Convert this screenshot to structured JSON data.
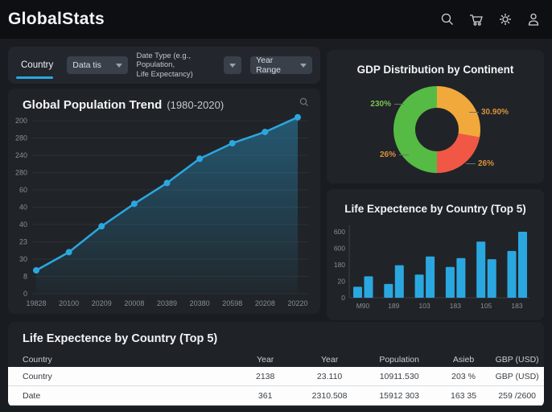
{
  "colors": {
    "accent_blue": "#2BA7E0",
    "grid_line": "#2b3036",
    "axis_text": "#878e95",
    "donut_green": "#55BB44",
    "donut_yellow": "#F2A93B",
    "donut_red": "#F05845"
  },
  "header": {
    "title": "GlobalStats",
    "icons": [
      "search",
      "cart",
      "settings",
      "user"
    ]
  },
  "filter_bar": {
    "active_tab": "Country",
    "data_dropdown": "Data tis",
    "data_type_label_line1": "Date Type (e.g., Population,",
    "data_type_label_line2": "Life Expectancy)",
    "year_range_dropdown": "Year Range"
  },
  "chart_data": [
    {
      "id": "population-trend",
      "type": "area",
      "title": "Global Population Trend",
      "title_suffix": "(1980-2020)",
      "x": [
        "19828",
        "20100",
        "20209",
        "20008",
        "20389",
        "20380",
        "20598",
        "20208",
        "20220"
      ],
      "values": [
        27,
        48,
        78,
        104,
        128,
        156,
        174,
        187,
        204
      ],
      "y_ticks_bottom_to_top": [
        "0",
        "8",
        "30",
        "23",
        "40",
        "40",
        "60",
        "280",
        "240",
        "280",
        "200"
      ],
      "ylim": [
        0,
        200
      ],
      "line_color": "#2BA7E0",
      "grid": true,
      "legend": "none"
    },
    {
      "id": "gdp-distribution",
      "type": "pie",
      "donut": true,
      "title": "GDP Distribution by Continent",
      "segments": [
        {
          "name": "yellow-slice",
          "start_deg": 0,
          "end_deg": 100,
          "color": "#F2A93B",
          "approx_share_pct": 28
        },
        {
          "name": "red-slice",
          "start_deg": 100,
          "end_deg": 180,
          "color": "#F05845",
          "approx_share_pct": 22
        },
        {
          "name": "green-slice",
          "start_deg": 180,
          "end_deg": 360,
          "color": "#55BB44",
          "approx_share_pct": 50
        }
      ],
      "labels": [
        {
          "text": "230%",
          "position": "left",
          "color": "#7DC050"
        },
        {
          "text": "30.90%",
          "position": "right",
          "color": "#D9913C"
        },
        {
          "text": "26%",
          "position": "bottom-left",
          "color": "#D9913C"
        },
        {
          "text": "26%",
          "position": "bottom-right",
          "color": "#D9913C"
        }
      ]
    },
    {
      "id": "life-expectancy-bars",
      "type": "bar",
      "title": "Life Expectence by Country (Top 5)",
      "categories": [
        "M90",
        "189",
        "103",
        "183",
        "105",
        "183"
      ],
      "series": [
        {
          "name": "series-1",
          "values": [
            100,
            125,
            210,
            280,
            510,
            425
          ]
        },
        {
          "name": "series-2",
          "values": [
            195,
            295,
            375,
            360,
            350,
            600
          ]
        }
      ],
      "y_ticks_bottom_to_top": [
        "0",
        "20",
        "180",
        "600",
        "600"
      ],
      "ylim": [
        0,
        600
      ],
      "bar_color": "#2BA7E0",
      "grid": false,
      "legend": "none"
    }
  ],
  "table": {
    "title": "Life Expectence by Country (Top 5)",
    "columns": [
      "Country",
      "Year",
      "Year",
      "Population",
      "Asieb",
      "GBP (USD)"
    ],
    "rows": [
      [
        "Country",
        "2138",
        "23.110",
        "10911.530",
        "203 %",
        "GBP (USD)"
      ],
      [
        "Date",
        "361",
        "2310.508",
        "15912 303",
        "163 35",
        "259 /2600"
      ]
    ]
  }
}
